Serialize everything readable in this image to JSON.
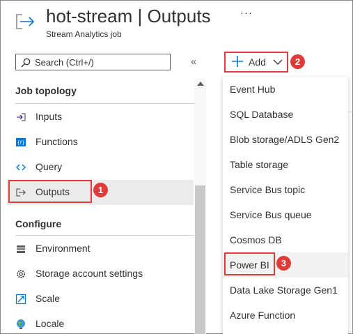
{
  "header": {
    "title": "hot-stream",
    "separator": "|",
    "section": "Outputs",
    "more": "···",
    "subtitle": "Stream Analytics job",
    "icon": "stream-output-icon"
  },
  "search": {
    "placeholder": "Search (Ctrl+/)",
    "collapse_glyph": "«"
  },
  "sidebar": {
    "sections": [
      {
        "label": "Job topology",
        "items": [
          {
            "label": "Inputs",
            "icon": "inputs-icon"
          },
          {
            "label": "Functions",
            "icon": "functions-icon"
          },
          {
            "label": "Query",
            "icon": "query-icon"
          },
          {
            "label": "Outputs",
            "icon": "outputs-icon",
            "selected": true
          }
        ]
      },
      {
        "label": "Configure",
        "items": [
          {
            "label": "Environment",
            "icon": "environment-icon"
          },
          {
            "label": "Storage account settings",
            "icon": "gear-icon"
          },
          {
            "label": "Scale",
            "icon": "scale-icon"
          },
          {
            "label": "Locale",
            "icon": "globe-icon"
          }
        ]
      }
    ]
  },
  "toolbar": {
    "add_label": "Add"
  },
  "add_menu": {
    "items": [
      "Event Hub",
      "SQL Database",
      "Blob storage/ADLS Gen2",
      "Table storage",
      "Service Bus topic",
      "Service Bus queue",
      "Cosmos DB",
      "Power BI",
      "Data Lake Storage Gen1",
      "Azure Function"
    ],
    "highlighted": "Power BI"
  },
  "callouts": {
    "step1": "1",
    "step2": "2",
    "step3": "3"
  },
  "colors": {
    "accent_blue": "#0078d4",
    "callout_red": "#e03a3a",
    "selected_bg": "#edebe9"
  }
}
